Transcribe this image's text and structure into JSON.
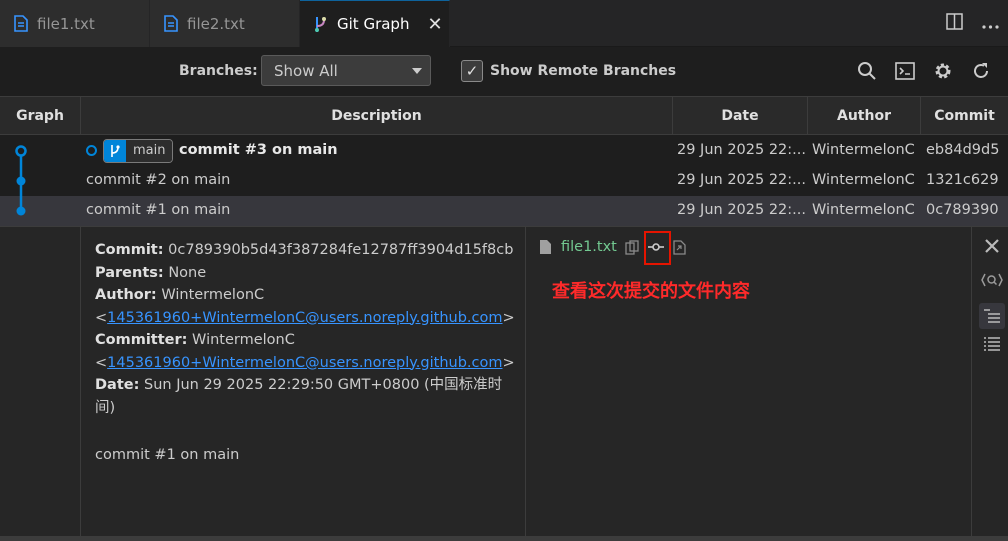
{
  "tabs": [
    {
      "label": "file1.txt"
    },
    {
      "label": "file2.txt"
    },
    {
      "label": "Git Graph",
      "close": "✕"
    }
  ],
  "controls": {
    "branches_label": "Branches:",
    "branches_value": "Show All",
    "show_remote_label": "Show Remote Branches",
    "show_remote_checked": true
  },
  "table": {
    "headers": [
      "Graph",
      "Description",
      "Date",
      "Author",
      "Commit"
    ],
    "rows": [
      {
        "branch": "main",
        "description": "commit #3 on main",
        "date": "29 Jun 2025 22:...",
        "author": "WintermelonC",
        "commit": "eb84d9d5"
      },
      {
        "description": "commit #2 on main",
        "date": "29 Jun 2025 22:...",
        "author": "WintermelonC",
        "commit": "1321c629"
      },
      {
        "description": "commit #1 on main",
        "date": "29 Jun 2025 22:...",
        "author": "WintermelonC",
        "commit": "0c789390"
      }
    ]
  },
  "details": {
    "commit_label": "Commit:",
    "commit_value": "0c789390b5d43f387284fe12787ff3904d15f8cb",
    "parents_label": "Parents:",
    "parents_value": "None",
    "author_label": "Author:",
    "author_name": "WintermelonC",
    "author_email": "145361960+WintermelonC@users.noreply.github.com",
    "committer_label": "Committer:",
    "committer_name": "WintermelonC",
    "committer_email": "145361960+WintermelonC@users.noreply.github.com",
    "date_label": "Date:",
    "date_value": "Sun Jun 29 2025 22:29:50 GMT+0800 (中国标准时",
    "date_value_cont": "间)",
    "message": "commit #1 on main",
    "file_name": "file1.txt",
    "annotation": "查看这次提交的文件内容"
  },
  "colors": {
    "accent": "#0085d9",
    "link": "#3794ff",
    "file_added": "#73c991",
    "highlight": "#e51400"
  },
  "icons": [
    "file-icon",
    "git-graph-icon",
    "split-editor-icon",
    "more-icon",
    "search-icon",
    "terminal-icon",
    "gear-icon",
    "refresh-icon",
    "copy-icon",
    "view-diff-icon",
    "open-file-icon",
    "close-icon",
    "find-icon",
    "tree-view-icon",
    "list-view-icon"
  ]
}
